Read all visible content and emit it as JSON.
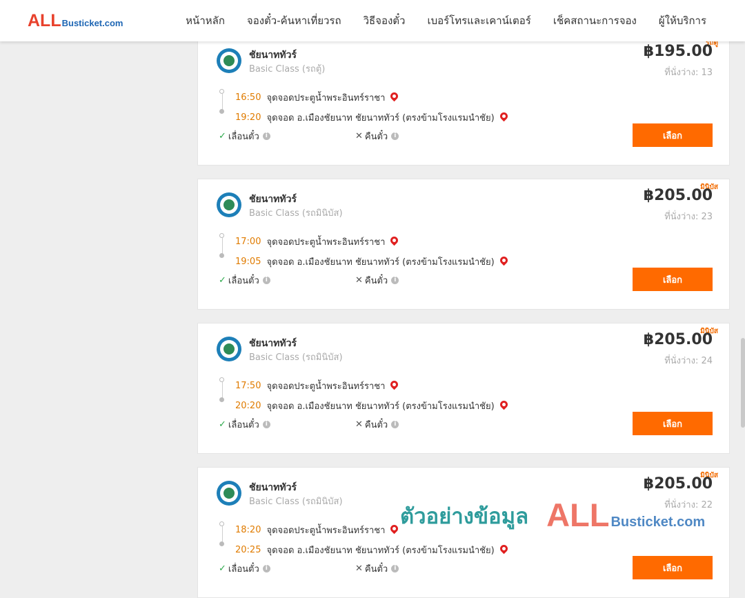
{
  "header": {
    "logo_all": "ALL",
    "logo_busticket": "Busticket.com",
    "nav": [
      "หน้าหลัก",
      "จองตั๋ว-ค้นหาเที่ยวรถ",
      "วิธีจองตั๋ว",
      "เบอร์โทรและเคาน์เตอร์",
      "เช็คสถานะการจอง",
      "ผู้ให้บริการ"
    ]
  },
  "trips": [
    {
      "badge": "รถตู้",
      "operator": "ชัยนาททัวร์",
      "class": "Basic Class (รถตู้)",
      "price": "฿195.00",
      "seats": "ที่นั่งว่าง: 13",
      "depart_time": "16:50",
      "depart_place": "จุดจอดประตูน้ำพระอินทร์ราชา",
      "arrive_time": "19:20",
      "arrive_place": "จุดจอด อ.เมืองชัยนาท ชัยนาททัวร์ (ตรงข้ามโรงแรมนำชัย)",
      "reschedule": "เลื่อนตั๋ว",
      "refund": "คืนตั๋ว",
      "button": "เลือก"
    },
    {
      "badge": "มินิบัส",
      "operator": "ชัยนาททัวร์",
      "class": "Basic Class (รถมินิบัส)",
      "price": "฿205.00",
      "seats": "ที่นั่งว่าง: 23",
      "depart_time": "17:00",
      "depart_place": "จุดจอดประตูน้ำพระอินทร์ราชา",
      "arrive_time": "19:05",
      "arrive_place": "จุดจอด อ.เมืองชัยนาท ชัยนาททัวร์ (ตรงข้ามโรงแรมนำชัย)",
      "reschedule": "เลื่อนตั๋ว",
      "refund": "คืนตั๋ว",
      "button": "เลือก"
    },
    {
      "badge": "มินิบัส",
      "operator": "ชัยนาททัวร์",
      "class": "Basic Class (รถมินิบัส)",
      "price": "฿205.00",
      "seats": "ที่นั่งว่าง: 24",
      "depart_time": "17:50",
      "depart_place": "จุดจอดประตูน้ำพระอินทร์ราชา",
      "arrive_time": "20:20",
      "arrive_place": "จุดจอด อ.เมืองชัยนาท ชัยนาททัวร์ (ตรงข้ามโรงแรมนำชัย)",
      "reschedule": "เลื่อนตั๋ว",
      "refund": "คืนตั๋ว",
      "button": "เลือก"
    },
    {
      "badge": "มินิบัส",
      "operator": "ชัยนาททัวร์",
      "class": "Basic Class (รถมินิบัส)",
      "price": "฿205.00",
      "seats": "ที่นั่งว่าง: 22",
      "depart_time": "18:20",
      "depart_place": "จุดจอดประตูน้ำพระอินทร์ราชา",
      "arrive_time": "20:25",
      "arrive_place": "จุดจอด อ.เมืองชัยนาท ชัยนาททัวร์ (ตรงข้ามโรงแรมนำชัย)",
      "reschedule": "เลื่อนตั๋ว",
      "refund": "คืนตั๋ว",
      "button": "เลือก"
    }
  ],
  "watermark": {
    "text": "ตัวอย่างข้อมูล",
    "all": "ALL",
    "busticket": "Busticket.com"
  }
}
